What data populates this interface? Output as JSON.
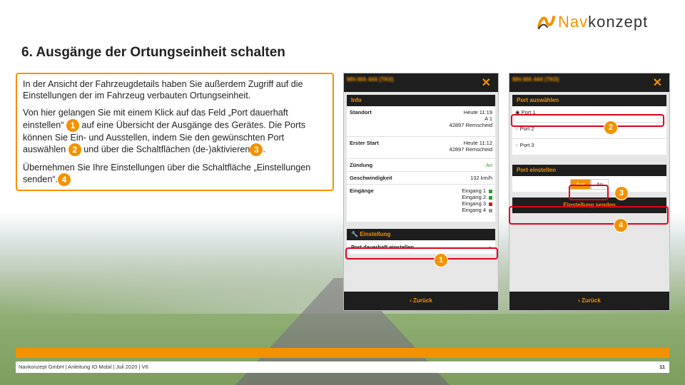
{
  "logo": {
    "part1": "Nav",
    "part2": "konzept"
  },
  "title": "6. Ausgänge der Ortungseinheit schalten",
  "text": {
    "p1": "In der Ansicht der Fahrzeugdetails haben Sie außerdem Zugriff auf die Einstellungen der im Fahrzeug verbauten Ortungseinheit.",
    "p2a": "Von hier gelangen Sie mit einem Klick auf das Feld „Port dauerhaft einstellen“",
    "p2b": "auf eine Übersicht der Ausgänge des Gerätes. Die Ports können Sie Ein- und Ausstellen, indem Sie den gewünschten Port auswählen",
    "p2c": "und über die Schaltflächen (de-)aktivieren",
    "p2d": ".",
    "p3a": "Übernehmen Sie Ihre Einstellungen über die Schaltfläche „Einstellungen senden“.",
    "b1": "1",
    "b2": "2",
    "b3": "3",
    "b4": "4"
  },
  "phone1": {
    "header": "MH-MA 444 (TK0)",
    "info_title": "Info",
    "rows": [
      {
        "label": "Standort",
        "value1": "Heute 11:19",
        "value2": "A 1",
        "value3": "42897 Remscheid"
      },
      {
        "label": "Erster Start",
        "value1": "Heute 11:12",
        "value2": "42897 Remscheid"
      },
      {
        "label": "Zündung",
        "value1": "An"
      },
      {
        "label": "Geschwindigkeit",
        "value1": "132 km/h"
      }
    ],
    "inputs_label": "Eingänge",
    "inputs": [
      {
        "name": "Eingang 1",
        "color": "#2e9e2e"
      },
      {
        "name": "Eingang 2",
        "color": "#2e9e2e"
      },
      {
        "name": "Eingang 3",
        "color": "#d62020"
      },
      {
        "name": "Eingang 4",
        "color": "#999999"
      }
    ],
    "setting_title": "Einstellung",
    "port_link": "Port dauerhaft einstellen",
    "back": "‹ Zurück",
    "badge": "1"
  },
  "phone2": {
    "header": "MH-MA 444 (TK0)",
    "select_title": "Port auswählen",
    "ports": [
      "Port 1",
      "Port 2",
      "Port 3"
    ],
    "set_title": "Port einstellen",
    "btn_off": "Aus",
    "btn_on": "An",
    "send": "Einstellung senden",
    "back": "‹ Zurück",
    "badges": [
      "2",
      "3",
      "4"
    ]
  },
  "footer": {
    "left": "Navkonzept GmbH  |  Anleitung IO Mobil  |  Juli 2020  |  V6",
    "page": "11"
  },
  "colors": {
    "accent": "#f39200",
    "dark": "#1e1e1e",
    "highlight": "#e3001b"
  }
}
